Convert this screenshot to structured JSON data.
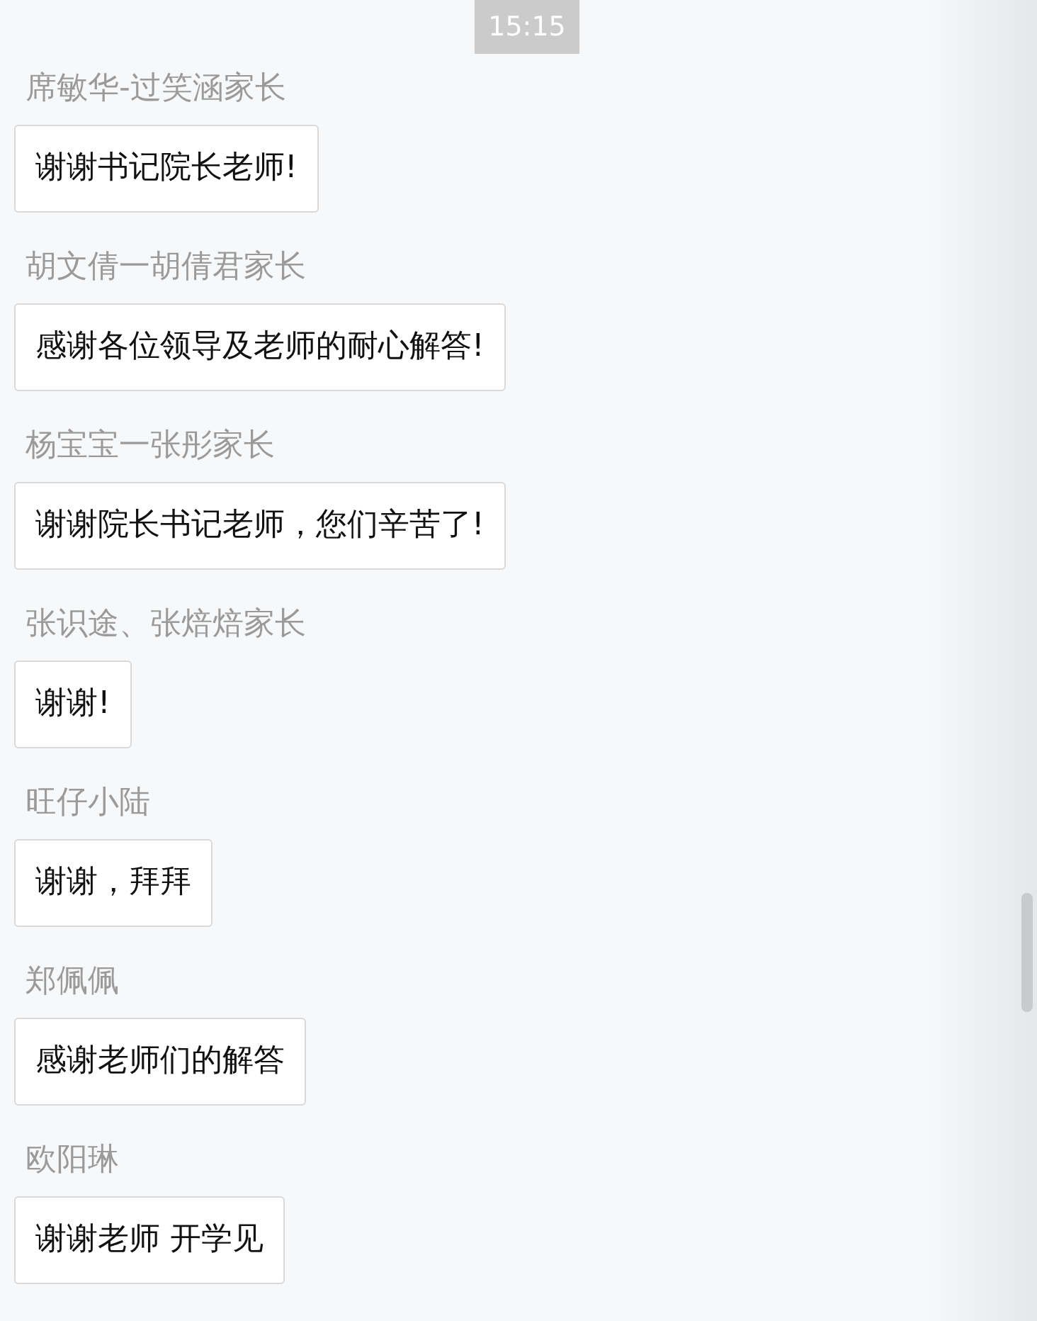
{
  "timestamp": "15:15",
  "messages": [
    {
      "sender": "席敏华-过笑涵家长",
      "text": "谢谢书记院长老师!"
    },
    {
      "sender": "胡文倩一胡倩君家长",
      "text": "感谢各位领导及老师的耐心解答!"
    },
    {
      "sender": "杨宝宝一张彤家长",
      "text": "谢谢院长书记老师，您们辛苦了!"
    },
    {
      "sender": "张识途、张焙焙家长",
      "text": "谢谢!"
    },
    {
      "sender": "旺仔小陆",
      "text": "谢谢，拜拜"
    },
    {
      "sender": "郑佩佩",
      "text": "感谢老师们的解答"
    },
    {
      "sender": "欧阳琳",
      "text": "谢谢老师 开学见"
    }
  ]
}
